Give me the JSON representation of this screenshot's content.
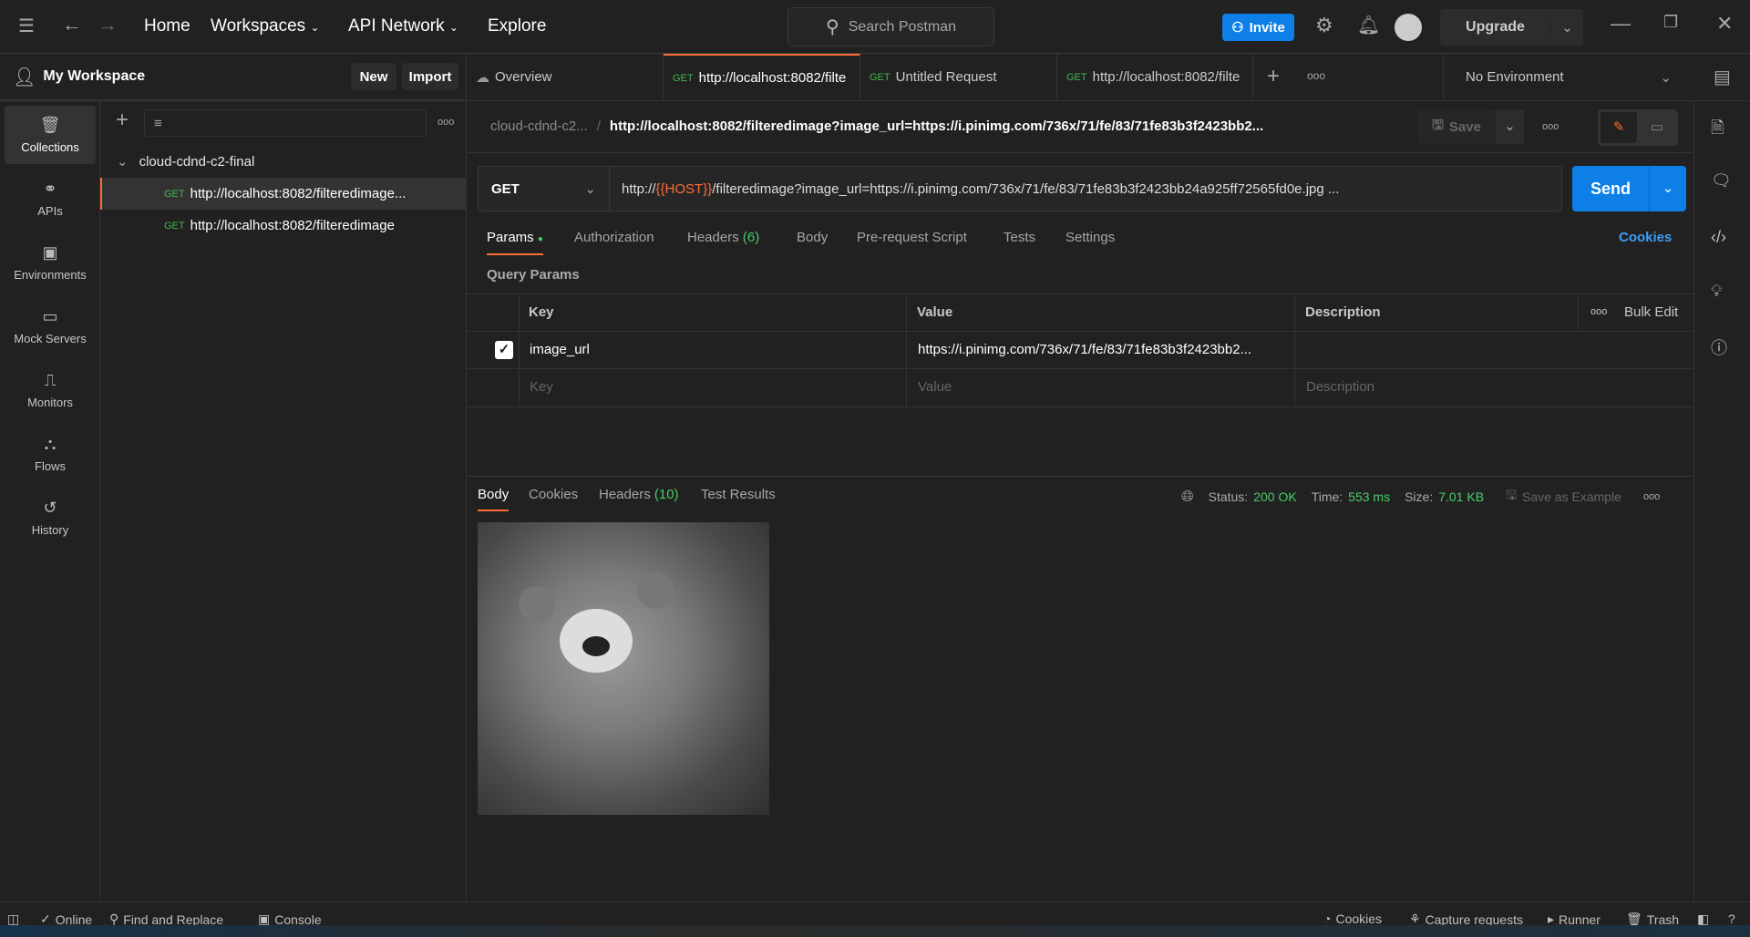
{
  "topbar": {
    "nav": [
      "Home",
      "Workspaces",
      "API Network",
      "Explore"
    ],
    "search_placeholder": "Search Postman",
    "invite": "Invite",
    "upgrade": "Upgrade"
  },
  "workspace": {
    "title": "My Workspace",
    "new": "New",
    "import": "Import"
  },
  "tabs": [
    {
      "label": "Overview"
    },
    {
      "method": "GET",
      "label": "http://localhost:8082/filte"
    },
    {
      "method": "GET",
      "label": "Untitled Request"
    },
    {
      "method": "GET",
      "label": "http://localhost:8082/filte"
    }
  ],
  "environment": "No Environment",
  "sidenav": [
    "Collections",
    "APIs",
    "Environments",
    "Mock Servers",
    "Monitors",
    "Flows",
    "History"
  ],
  "collection": {
    "name": "cloud-cdnd-c2-final",
    "requests": [
      {
        "method": "GET",
        "label": "http://localhost:8082/filteredimage..."
      },
      {
        "method": "GET",
        "label": "http://localhost:8082/filteredimage"
      }
    ]
  },
  "breadcrumb": {
    "collection": "cloud-cdnd-c2...",
    "request": "http://localhost:8082/filteredimage?image_url=https://i.pinimg.com/736x/71/fe/83/71fe83b3f2423bb2...",
    "save": "Save"
  },
  "request": {
    "method": "GET",
    "url_prefix": "http://",
    "url_var": "{{HOST}}",
    "url_rest": "/filteredimage?image_url=https://i.pinimg.com/736x/71/fe/83/71fe83b3f2423bb24a925ff72565fd0e.jpg ...",
    "send": "Send"
  },
  "req_tabs": {
    "params": "Params",
    "authorization": "Authorization",
    "headers": "Headers",
    "headers_count": "(6)",
    "body": "Body",
    "prerequest": "Pre-request Script",
    "tests": "Tests",
    "settings": "Settings",
    "cookies": "Cookies"
  },
  "query": {
    "title": "Query Params",
    "headers": [
      "Key",
      "Value",
      "Description"
    ],
    "bulk_edit": "Bulk Edit",
    "rows": [
      {
        "checked": true,
        "key": "image_url",
        "value": "https://i.pinimg.com/736x/71/fe/83/71fe83b3f2423bb2...",
        "description": ""
      }
    ],
    "placeholders": {
      "key": "Key",
      "value": "Value",
      "description": "Description"
    }
  },
  "response": {
    "tabs": {
      "body": "Body",
      "cookies": "Cookies",
      "headers": "Headers",
      "headers_count": "(10)",
      "tests": "Test Results"
    },
    "status_label": "Status:",
    "status": "200 OK",
    "time_label": "Time:",
    "time": "553 ms",
    "size_label": "Size:",
    "size": "7.01 KB",
    "save_example": "Save as Example"
  },
  "statusbar": {
    "online": "Online",
    "find": "Find and Replace",
    "console": "Console",
    "cookies": "Cookies",
    "capture": "Capture requests",
    "runner": "Runner",
    "trash": "Trash"
  }
}
